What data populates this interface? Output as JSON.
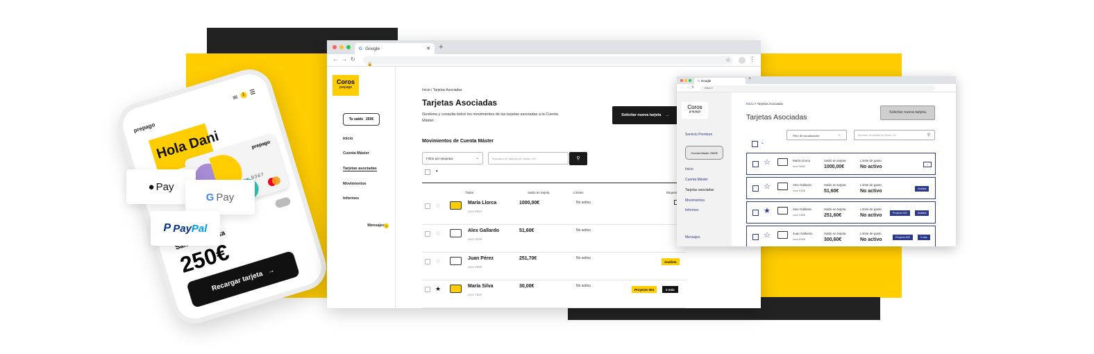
{
  "colors": {
    "brand_yellow": "#FFCD00",
    "dark": "#222222",
    "wire_blue": "#2C3A8C"
  },
  "phone": {
    "brand": "prepago",
    "greeting": "Hola Dani",
    "card_brand": "prepago",
    "card_number": "xxxx xxxx 9367",
    "badge": "1",
    "balance_label": "Saldo en tarjeta",
    "balance_value": "250€",
    "recharge_button": "Recargar tarjeta"
  },
  "payments": {
    "apple": "Pay",
    "google": "Pay",
    "paypal_a": "Pay",
    "paypal_b": "Pal"
  },
  "browser": {
    "tab_title": "Google",
    "logo_name": "Coros",
    "logo_sub": "prepago",
    "saldo_label": "Tu saldo",
    "saldo_value": "250€",
    "nav": [
      "Inicio",
      "Cuenta Máster",
      "Tarjetas asociadas",
      "Movimientos",
      "Informes",
      "Mensajes"
    ],
    "msg_badge": "2",
    "breadcrumb": "Inicio / Tarjetas Asociadas",
    "title": "Tarjetas Asociadas",
    "description": "Gestiona y consulta todos los movimientos de las tarjetas asociadas a la Cuenta Máster.",
    "cta": "Solicitar nueva tarjeta",
    "subtitle": "Movimientos de Cuenta Máster",
    "filter": "Filtrar por etiquetas",
    "search_placeholder": "Buscador de tarjetas por titular o ID",
    "headers": [
      "Titular",
      "Saldo en tarjeta",
      "Límites",
      "Etiquetas"
    ],
    "rows": [
      {
        "name": "María Llorca",
        "num": "xxxx 9654",
        "saldo": "1000,00€",
        "limit": "No activo",
        "star": false,
        "tags": []
      },
      {
        "name": "Alex Gallardo",
        "num": "xxxx 3246",
        "saldo": "51,60€",
        "limit": "No activo",
        "star": false,
        "tags": []
      },
      {
        "name": "Juan Pérez",
        "num": "xxxx 2589",
        "saldo": "251,70€",
        "limit": "No activo",
        "star": false,
        "tags": [
          "Analista"
        ]
      },
      {
        "name": "María Silva",
        "num": "xxxx 7820",
        "saldo": "30,00€",
        "limit": "No activo",
        "star": true,
        "tags": [
          "Proyecto 004",
          "2 más"
        ]
      }
    ]
  },
  "wire": {
    "tab_title": "Google",
    "url": "https://",
    "logo_name": "Coros",
    "logo_sub": "prepago",
    "nav_top": "Servicio Premium",
    "saldo_pill": "Cuenta Máster  2500€",
    "nav": [
      "Inicio",
      "Cuenta Máster",
      "Tarjetas asociadas",
      "Movimientos",
      "Informes"
    ],
    "nav_bottom": "Mensajes",
    "breadcrumb_link": "Inicio",
    "breadcrumb_rest": " > Tarjetas Asociadas",
    "title": "Tarjetas Asociadas",
    "cta": "Solicitar nueva tarjeta",
    "filter": "Filtro de visualización",
    "search_placeholder": "Buscador de tarjetas por titular o ID",
    "saldo_label": "Saldo en tarjeta",
    "limit_label": "Límite de gasto",
    "rows": [
      {
        "name": "María Llorca",
        "num": "xxxx 9654",
        "saldo": "1000,00€",
        "limit": "No activo",
        "star": false,
        "tags": [
          "+"
        ]
      },
      {
        "name": "Alex Gallardo",
        "num": "xxxx 5358",
        "saldo": "51,60€",
        "limit": "No activo",
        "star": false,
        "tags": [
          "Analista"
        ]
      },
      {
        "name": "Alex Gallardo",
        "num": "xxxx 5358",
        "saldo": "251,60€",
        "limit": "No activo",
        "star": true,
        "tags": [
          "Proyecto 003",
          "Analista"
        ]
      },
      {
        "name": "Juan Gallardo",
        "num": "xxxx 5358",
        "saldo": "300,60€",
        "limit": "No activo",
        "star": false,
        "tags": [
          "Proyecto 003",
          "2 más"
        ]
      }
    ]
  }
}
